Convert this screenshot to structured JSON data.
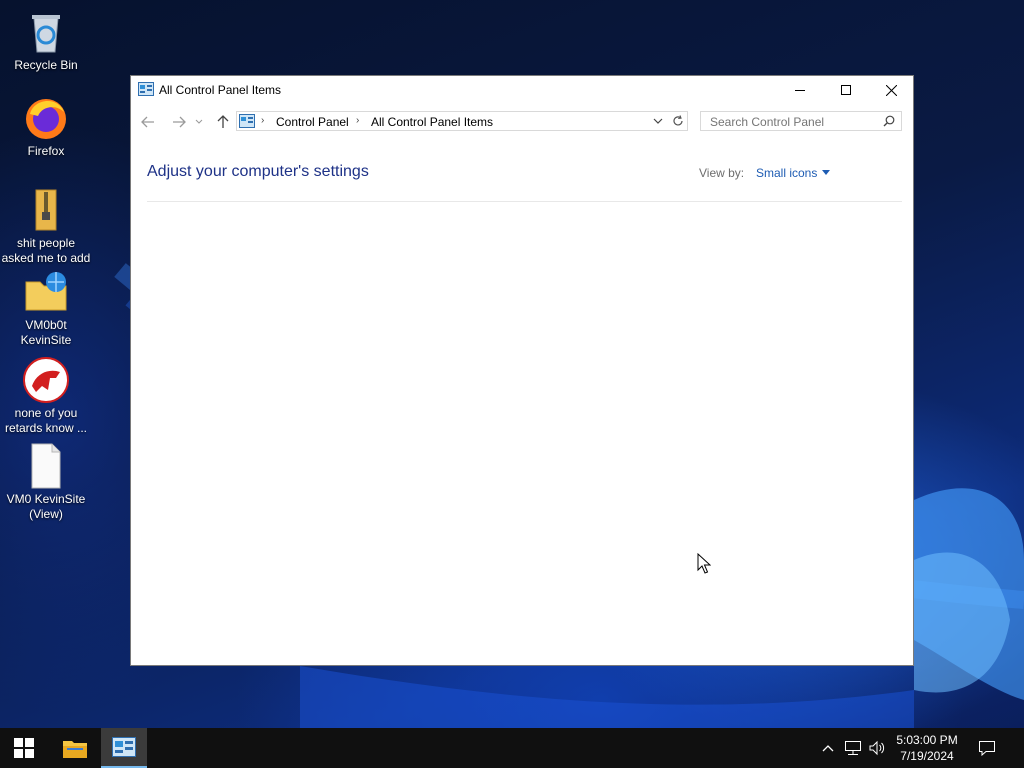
{
  "desktop": {
    "icons": [
      {
        "label": "Recycle Bin"
      },
      {
        "label": "Firefox"
      },
      {
        "label": "shit people asked me to add"
      },
      {
        "label": "VM0b0t KevinSite"
      },
      {
        "label": "none of you retards know ..."
      },
      {
        "label": "VM0 KevinSite (View)"
      }
    ]
  },
  "window": {
    "title": "All Control Panel Items",
    "breadcrumb": [
      "Control Panel",
      "All Control Panel Items"
    ],
    "search_placeholder": "Search Control Panel",
    "heading": "Adjust your computer's settings",
    "view_by_label": "View by:",
    "view_by_value": "Small icons"
  },
  "taskbar": {
    "time": "5:03:00 PM",
    "date": "7/19/2024"
  },
  "colors": {
    "heading": "#1e3287",
    "link": "#1e5cb3",
    "taskbar": "#101010"
  }
}
